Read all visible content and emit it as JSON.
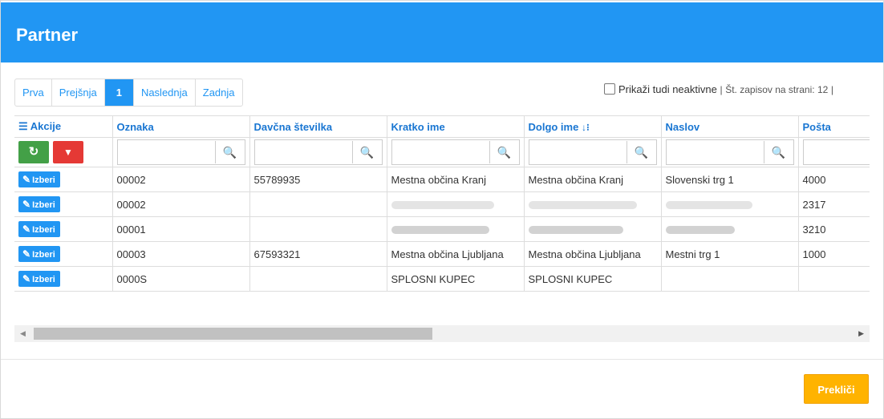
{
  "dialog": {
    "title": "Partner"
  },
  "pager": {
    "first": "Prva",
    "prev": "Prejšnja",
    "current": "1",
    "next": "Naslednja",
    "last": "Zadnja"
  },
  "options": {
    "show_inactive_label": "Prikaži tudi neaktivne",
    "separator": "|",
    "per_page_label": "Št. zapisov na strani: 12",
    "trailing_separator": "|"
  },
  "table": {
    "columns": [
      {
        "label": "Akcije",
        "icon": "list-icon"
      },
      {
        "label": "Oznaka"
      },
      {
        "label": "Davčna številka"
      },
      {
        "label": "Kratko ime"
      },
      {
        "label": "Dolgo ime",
        "icon": "sort-asc-icon"
      },
      {
        "label": "Naslov"
      },
      {
        "label": "Pošta"
      }
    ],
    "select_label": "Izberi",
    "search_glyph": "🔍",
    "refresh_glyph": "↻",
    "filter_glyph": "▼",
    "pencil_glyph": "✎",
    "sort_glyph": "↓⁝",
    "list_glyph": "☰",
    "rows": [
      {
        "oznaka": "00002",
        "davcna": "55789935",
        "kratko": "Mestna občina Kranj",
        "dolgo": "Mestna občina Kranj",
        "naslov": "Slovenski trg 1",
        "posta": "4000"
      },
      {
        "oznaka": "00002",
        "davcna": "",
        "kratko": "",
        "dolgo": "",
        "naslov": "",
        "posta": "2317"
      },
      {
        "oznaka": "00001",
        "davcna": "",
        "kratko": "",
        "dolgo": "",
        "naslov": "",
        "posta": "3210"
      },
      {
        "oznaka": "00003",
        "davcna": "67593321",
        "kratko": "Mestna občina Ljubljana",
        "dolgo": "Mestna občina Ljubljana",
        "naslov": "Mestni trg 1",
        "posta": "1000"
      },
      {
        "oznaka": "0000S",
        "davcna": "",
        "kratko": "SPLOSNI KUPEC",
        "dolgo": "SPLOSNI KUPEC",
        "naslov": "",
        "posta": ""
      }
    ]
  },
  "scrollbar": {
    "left_arrow": "◀",
    "right_arrow": "▶"
  },
  "footer": {
    "cancel_label": "Prekliči"
  },
  "colors": {
    "header": "#2196f3",
    "accent": "#2196f3",
    "refresh": "#43a047",
    "filter": "#e53935",
    "cancel": "#ffb300"
  }
}
